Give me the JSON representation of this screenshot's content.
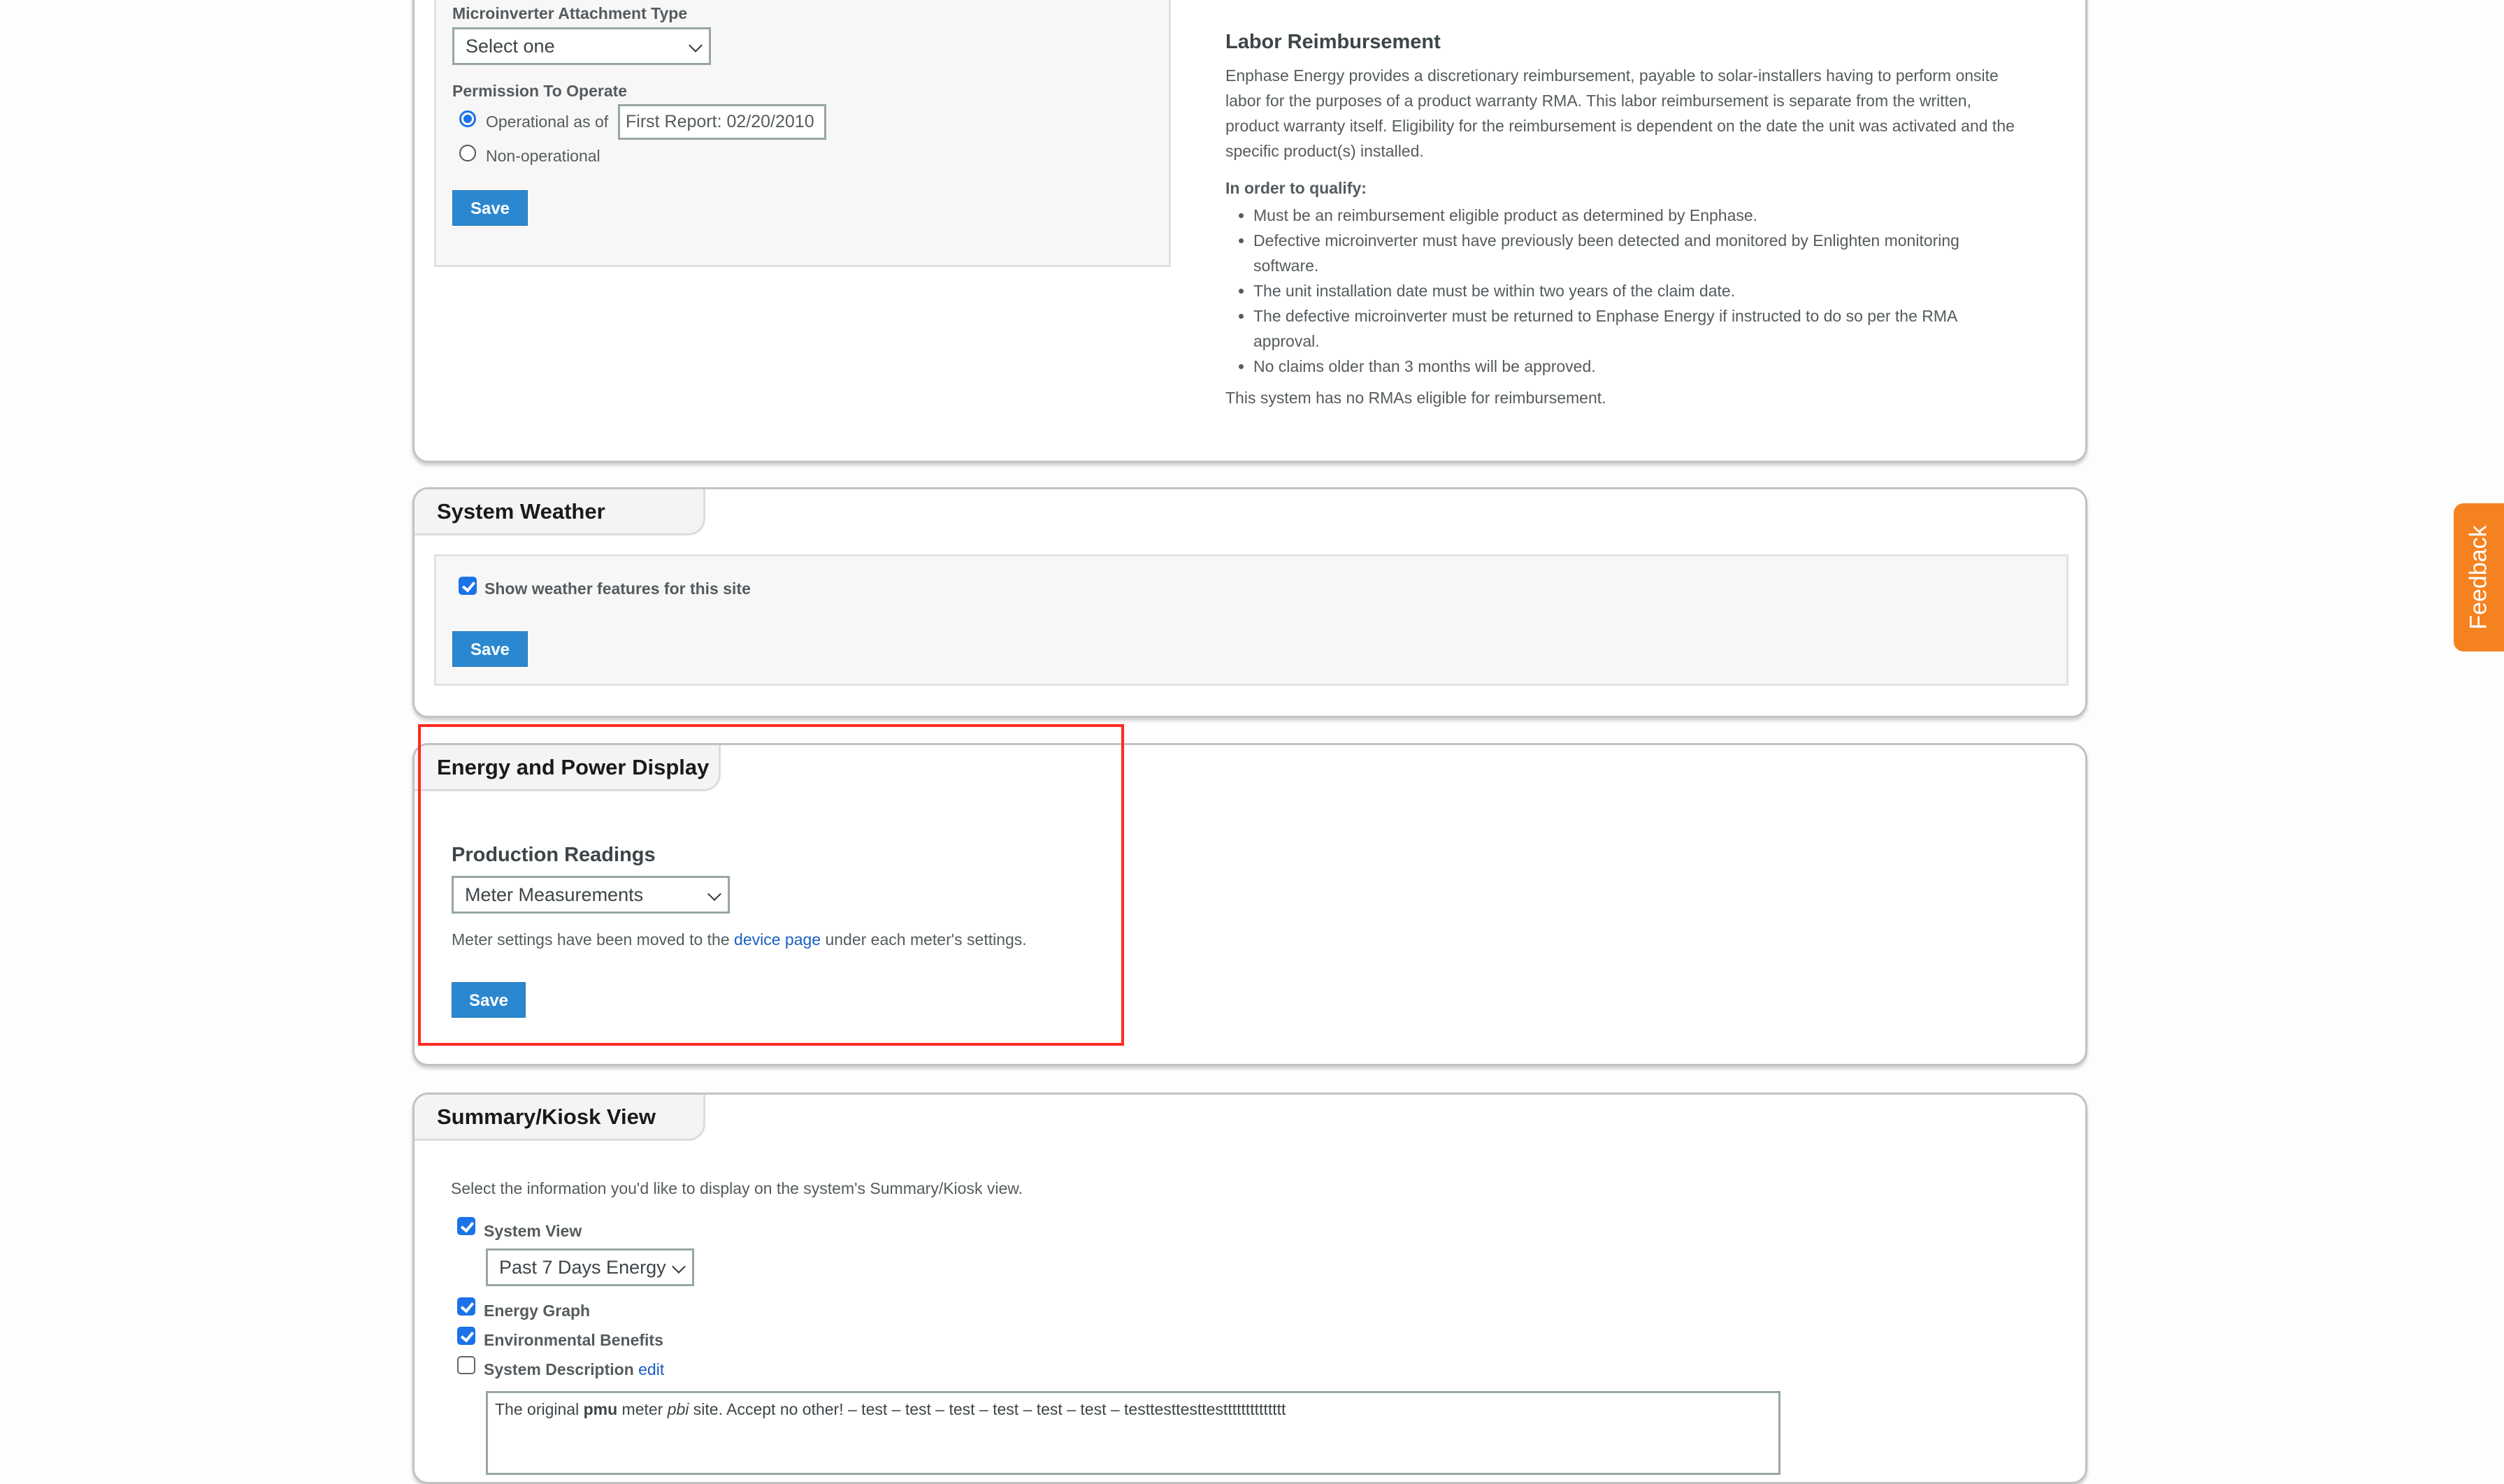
{
  "ptoPanel": {
    "attachmentType": {
      "label": "Microinverter Attachment Type",
      "selected": "Select one"
    },
    "permissionToOperate": {
      "label": "Permission To Operate",
      "options": [
        {
          "label": "Operational as of",
          "checked": true
        },
        {
          "label": "Non-operational",
          "checked": false
        }
      ],
      "dateValue": "First Report: 02/20/2010"
    },
    "saveLabel": "Save"
  },
  "laborReimbursement": {
    "title": "Labor Reimbursement",
    "paragraph": "Enphase Energy provides a discretionary reimbursement, payable to solar-installers having to perform onsite labor for the purposes of a product warranty RMA. This labor reimbursement is separate from the written, product warranty itself. Eligibility for the reimbursement is dependent on the date the unit was activated and the specific product(s) installed.",
    "qualifyHeading": "In order to qualify:",
    "requirements": [
      "Must be an reimbursement eligible product as determined by Enphase.",
      "Defective microinverter must have previously been detected and monitored by Enlighten monitoring software.",
      "The unit installation date must be within two years of the claim date.",
      "The defective microinverter must be returned to Enphase Energy if instructed to do so per the RMA approval.",
      "No claims older than 3 months will be approved."
    ],
    "footer": "This system has no RMAs eligible for reimbursement."
  },
  "systemWeather": {
    "title": "System Weather",
    "checkboxLabel": "Show weather features for this site",
    "checked": true,
    "saveLabel": "Save"
  },
  "energyPowerDisplay": {
    "title": "Energy and Power Display",
    "productionLabel": "Production Readings",
    "productionSelected": "Meter Measurements",
    "notePrefix": "Meter settings have been moved to the ",
    "noteLink": "device page",
    "noteSuffix": " under each meter's settings.",
    "saveLabel": "Save"
  },
  "summaryKiosk": {
    "title": "Summary/Kiosk View",
    "intro": "Select the information you'd like to display on the system's Summary/Kiosk view.",
    "systemView": {
      "label": "System View",
      "checked": true,
      "selected": "Past 7 Days Energy"
    },
    "energyGraph": {
      "label": "Energy Graph",
      "checked": true
    },
    "environmentalBenefits": {
      "label": "Environmental Benefits",
      "checked": true
    },
    "systemDescription": {
      "label": "System Description",
      "checked": false,
      "editLink": "edit"
    },
    "description": {
      "part1": "The original ",
      "bold": "pmu",
      "part2": " meter ",
      "italic": "pbi",
      "part3": " site. Accept no other! – test – test – test – test – test – test – testtesttesttestttttttttttttt"
    }
  },
  "feedback": {
    "label": "Feedback",
    "color": "#f58220"
  },
  "colors": {
    "accent": "#2b88d0",
    "highlight": "#ff2a1f",
    "link": "#1a5fc4"
  }
}
